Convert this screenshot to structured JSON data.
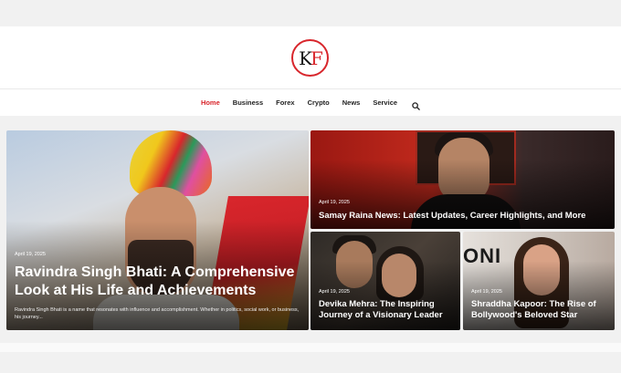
{
  "brand": {
    "logo_k": "K",
    "logo_f": "F"
  },
  "nav": {
    "items": [
      {
        "label": "Home",
        "active": true
      },
      {
        "label": "Business",
        "active": false
      },
      {
        "label": "Forex",
        "active": false
      },
      {
        "label": "Crypto",
        "active": false
      },
      {
        "label": "News",
        "active": false
      },
      {
        "label": "Service",
        "active": false
      }
    ],
    "search_icon": "search-icon"
  },
  "featured": {
    "main": {
      "date": "April 19, 2025",
      "title": "Ravindra Singh Bhati: A Comprehensive Look at His Life and Achievements",
      "excerpt": "Ravindra Singh Bhati is a name that resonates with influence and accomplishment. Whether in politics, social work, or business, his journey..."
    },
    "top_right": {
      "date": "April 19, 2025",
      "title": "Samay Raina News: Latest Updates, Career Highlights, and More"
    },
    "bottom_left": {
      "date": "April 19, 2025",
      "title": "Devika Mehra: The Inspiring Journey of a Visionary Leader"
    },
    "bottom_right": {
      "date": "April 19, 2025",
      "title": "Shraddha Kapoor: The Rise of Bollywood's Beloved Star",
      "bg_text": "ONI"
    }
  },
  "colors": {
    "accent": "#d8262c",
    "nav_text": "#222222"
  }
}
